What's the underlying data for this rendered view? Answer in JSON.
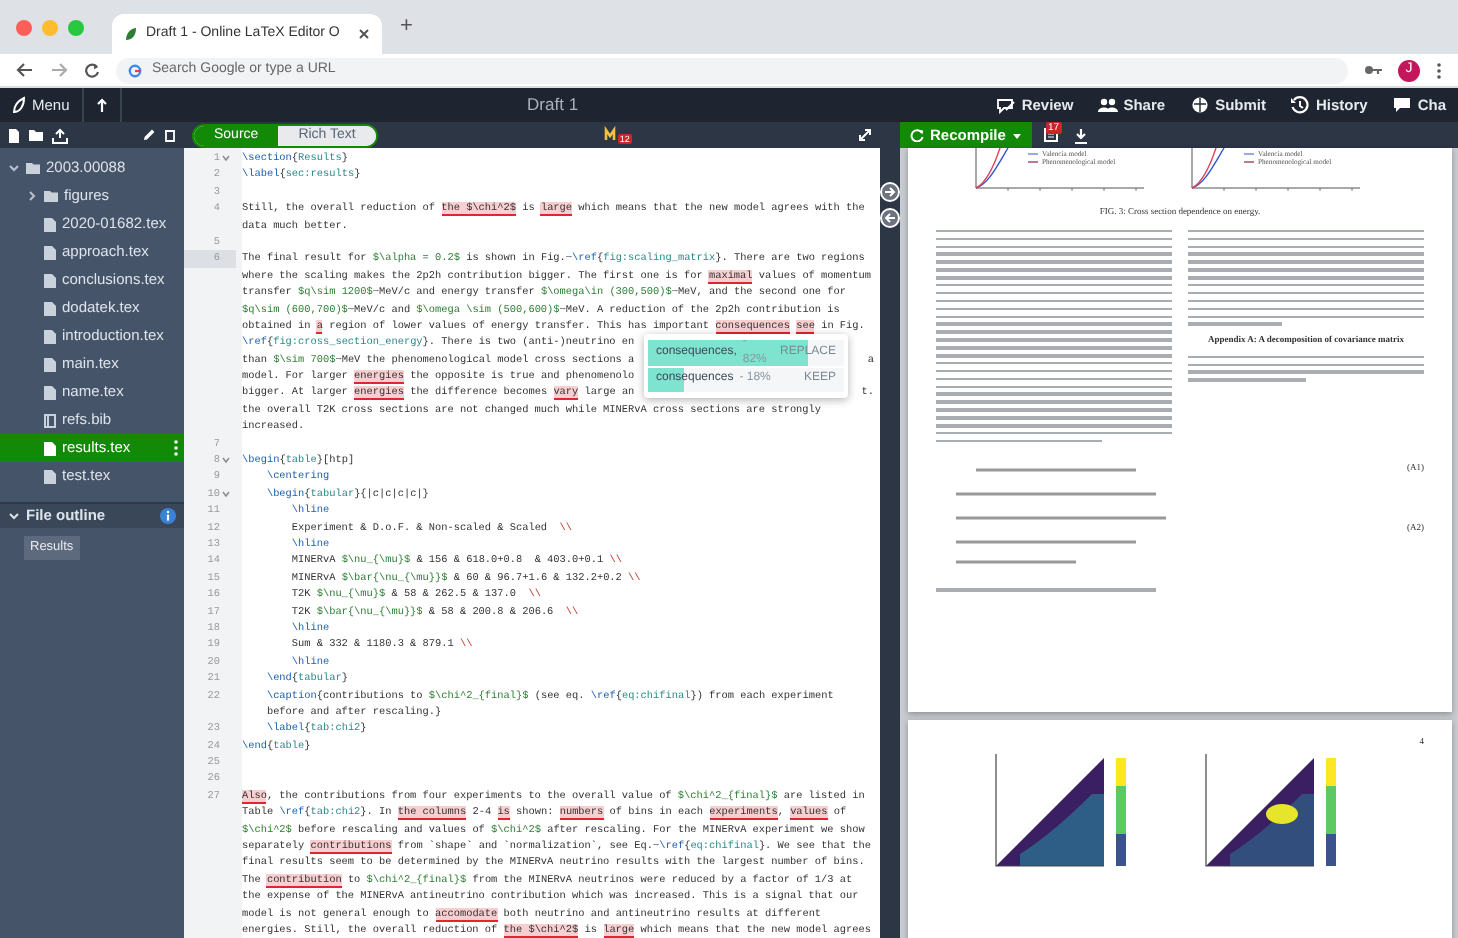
{
  "browser": {
    "tab_title": "Draft 1 - Online LaTeX Editor O",
    "new_tab": "+",
    "address_placeholder": "Search Google or type a URL",
    "avatar": "J"
  },
  "toolbar": {
    "menu": "Menu",
    "title": "Draft 1",
    "actions": [
      {
        "kind": "review",
        "label": "Review"
      },
      {
        "kind": "share",
        "label": "Share"
      },
      {
        "kind": "submit",
        "label": "Submit"
      },
      {
        "kind": "history",
        "label": "History"
      },
      {
        "kind": "chat",
        "label": "Cha"
      }
    ]
  },
  "file_tree": {
    "root": {
      "label": "2003.00088",
      "expanded": true,
      "children": [
        {
          "kind": "folder",
          "label": "figures",
          "selected": false
        },
        {
          "kind": "file",
          "label": "2020-01682.tex",
          "selected": false
        },
        {
          "kind": "file",
          "label": "approach.tex",
          "selected": false
        },
        {
          "kind": "file",
          "label": "conclusions.tex",
          "selected": false
        },
        {
          "kind": "file",
          "label": "dodatek.tex",
          "selected": false
        },
        {
          "kind": "file",
          "label": "introduction.tex",
          "selected": false
        },
        {
          "kind": "file",
          "label": "main.tex",
          "selected": false
        },
        {
          "kind": "file",
          "label": "name.tex",
          "selected": false
        },
        {
          "kind": "bib",
          "label": "refs.bib",
          "selected": false
        },
        {
          "kind": "file",
          "label": "results.tex",
          "selected": true
        },
        {
          "kind": "file",
          "label": "test.tex",
          "selected": false
        }
      ]
    }
  },
  "outline": {
    "title": "File outline",
    "expanded": true,
    "items": [
      "Results"
    ]
  },
  "editor": {
    "modes": [
      {
        "label": "Source",
        "selected": true
      },
      {
        "label": "Rich Text",
        "selected": false
      }
    ],
    "issues_badge": "12",
    "rows": [
      {
        "n": "1",
        "fold": true,
        "active": false,
        "segs": [
          {
            "kind": "cmd",
            "text": "\\section"
          },
          {
            "kind": "text",
            "text": "{"
          },
          {
            "kind": "arg",
            "text": "Results"
          },
          {
            "kind": "text",
            "text": "}"
          }
        ]
      },
      {
        "n": "2",
        "fold": false,
        "active": false,
        "segs": [
          {
            "kind": "cmd",
            "text": "\\label"
          },
          {
            "kind": "text",
            "text": "{"
          },
          {
            "kind": "arg",
            "text": "sec:results"
          },
          {
            "kind": "text",
            "text": "}"
          }
        ]
      },
      {
        "n": "3",
        "fold": false,
        "active": false,
        "segs": []
      },
      {
        "n": "4",
        "fold": false,
        "active": false,
        "segs": [
          {
            "kind": "text",
            "text": "Still, the overall reduction of "
          },
          {
            "kind": "flag",
            "text": "the $\\chi^2$"
          },
          {
            "kind": "text",
            "text": " is "
          },
          {
            "kind": "flag",
            "text": "large"
          },
          {
            "kind": "text",
            "text": " which means that the new model agrees with the"
          }
        ]
      },
      {
        "fold": false,
        "active": false,
        "segs": [
          {
            "kind": "text",
            "text": "data much better."
          }
        ]
      },
      {
        "n": "5",
        "fold": false,
        "active": false,
        "segs": []
      },
      {
        "n": "6",
        "fold": false,
        "active": true,
        "segs": [
          {
            "kind": "text",
            "text": "The final result for "
          },
          {
            "kind": "math",
            "text": "$\\alpha = 0.2$"
          },
          {
            "kind": "text",
            "text": " is shown in Fig.~"
          },
          {
            "kind": "cmd",
            "text": "\\ref"
          },
          {
            "kind": "text",
            "text": "{"
          },
          {
            "kind": "arg",
            "text": "fig:scaling_matrix"
          },
          {
            "kind": "text",
            "text": "}. There are two regions"
          }
        ]
      },
      {
        "fold": false,
        "active": false,
        "segs": [
          {
            "kind": "text",
            "text": "where the scaling makes the 2p2h contribution bigger. The first one is for "
          },
          {
            "kind": "flag",
            "text": "maximal"
          },
          {
            "kind": "text",
            "text": " values of momentum"
          }
        ]
      },
      {
        "fold": false,
        "active": false,
        "segs": [
          {
            "kind": "text",
            "text": "transfer "
          },
          {
            "kind": "math",
            "text": "$q\\sim 1200$"
          },
          {
            "kind": "text",
            "text": "~MeV/c and energy transfer "
          },
          {
            "kind": "math",
            "text": "$\\omega\\in (300,500)$"
          },
          {
            "kind": "text",
            "text": "~MeV, and the second one for"
          }
        ]
      },
      {
        "fold": false,
        "active": false,
        "segs": [
          {
            "kind": "math",
            "text": "$q\\sim (600,700)$"
          },
          {
            "kind": "text",
            "text": "~MeV/c and "
          },
          {
            "kind": "math",
            "text": "$\\omega \\sim (500,600)$"
          },
          {
            "kind": "text",
            "text": "~MeV. A reduction of the 2p2h contribution is"
          }
        ]
      },
      {
        "fold": false,
        "active": false,
        "segs": [
          {
            "kind": "text",
            "text": "obtained in "
          },
          {
            "kind": "flag",
            "text": "a"
          },
          {
            "kind": "text",
            "text": " region of lower values of energy transfer. This has important "
          },
          {
            "kind": "flag",
            "text": "consequences"
          },
          {
            "kind": "flag",
            "text": " see"
          },
          {
            "kind": "text",
            "text": " in Fig."
          }
        ]
      },
      {
        "fold": false,
        "active": false,
        "segs": [
          {
            "kind": "cmd",
            "text": "\\ref"
          },
          {
            "kind": "text",
            "text": "{"
          },
          {
            "kind": "arg",
            "text": "fig:cross_section_energy"
          },
          {
            "kind": "text",
            "text": "}. There is two (anti-)neutrino en"
          }
        ]
      },
      {
        "fold": false,
        "active": false,
        "segs": [
          {
            "kind": "text",
            "text": "than "
          },
          {
            "kind": "math",
            "text": "$\\sim 700$"
          },
          {
            "kind": "text",
            "text": "~MeV the phenomenological model cross sections a"
          }
        ],
        "tail": "a"
      },
      {
        "fold": false,
        "active": false,
        "segs": [
          {
            "kind": "text",
            "text": "model. For larger "
          },
          {
            "kind": "flag",
            "text": "energies"
          },
          {
            "kind": "text",
            "text": " the opposite is true and phenomenolo"
          }
        ]
      },
      {
        "fold": false,
        "active": false,
        "segs": [
          {
            "kind": "text",
            "text": "bigger. At larger "
          },
          {
            "kind": "flag",
            "text": "energies"
          },
          {
            "kind": "text",
            "text": " the difference becomes "
          },
          {
            "kind": "flag",
            "text": "vary"
          },
          {
            "kind": "text",
            "text": " large an"
          }
        ],
        "tail": "t."
      },
      {
        "fold": false,
        "active": false,
        "segs": [
          {
            "kind": "text",
            "text": "the overall T2K cross sections are not changed much while MINERvA cross sections are strongly"
          }
        ]
      },
      {
        "fold": false,
        "active": false,
        "segs": [
          {
            "kind": "text",
            "text": "increased."
          }
        ]
      },
      {
        "n": "7",
        "fold": false,
        "active": false,
        "segs": []
      },
      {
        "n": "8",
        "fold": true,
        "active": false,
        "segs": [
          {
            "kind": "cmd",
            "text": "\\begin"
          },
          {
            "kind": "text",
            "text": "{"
          },
          {
            "kind": "arg",
            "text": "table"
          },
          {
            "kind": "text",
            "text": "}[htp]"
          }
        ]
      },
      {
        "n": "9",
        "fold": false,
        "active": false,
        "segs": [
          {
            "kind": "cmd",
            "text": "    \\centering"
          }
        ]
      },
      {
        "n": "10",
        "fold": true,
        "active": false,
        "segs": [
          {
            "kind": "cmd",
            "text": "    \\begin"
          },
          {
            "kind": "text",
            "text": "{"
          },
          {
            "kind": "arg",
            "text": "tabular"
          },
          {
            "kind": "text",
            "text": "}{|c|c|c|c|}"
          }
        ]
      },
      {
        "n": "11",
        "fold": false,
        "active": false,
        "segs": [
          {
            "kind": "cmd",
            "text": "        \\hline"
          }
        ]
      },
      {
        "n": "12",
        "fold": false,
        "active": false,
        "segs": [
          {
            "kind": "text",
            "text": "        Experiment & D.o.F. & Non-scaled & Scaled  "
          },
          {
            "kind": "esc",
            "text": "\\\\"
          }
        ]
      },
      {
        "n": "13",
        "fold": false,
        "active": false,
        "segs": [
          {
            "kind": "cmd",
            "text": "        \\hline"
          }
        ]
      },
      {
        "n": "14",
        "fold": false,
        "active": false,
        "segs": [
          {
            "kind": "text",
            "text": "        MINERvA "
          },
          {
            "kind": "math",
            "text": "$\\nu_{\\mu}$"
          },
          {
            "kind": "text",
            "text": " & 156 & 618.0+0.8  & 403.0+0.1 "
          },
          {
            "kind": "esc",
            "text": "\\\\"
          }
        ]
      },
      {
        "n": "15",
        "fold": false,
        "active": false,
        "segs": [
          {
            "kind": "text",
            "text": "        MINERvA "
          },
          {
            "kind": "math",
            "text": "$\\bar{\\nu_{\\mu}}$"
          },
          {
            "kind": "text",
            "text": " & 60 & 96.7+1.6 & 132.2+0.2 "
          },
          {
            "kind": "esc",
            "text": "\\\\"
          }
        ]
      },
      {
        "n": "16",
        "fold": false,
        "active": false,
        "segs": [
          {
            "kind": "text",
            "text": "        T2K "
          },
          {
            "kind": "math",
            "text": "$\\nu_{\\mu}$"
          },
          {
            "kind": "text",
            "text": " & 58 & 262.5 & 137.0  "
          },
          {
            "kind": "esc",
            "text": "\\\\"
          }
        ]
      },
      {
        "n": "17",
        "fold": false,
        "active": false,
        "segs": [
          {
            "kind": "text",
            "text": "        T2K "
          },
          {
            "kind": "math",
            "text": "$\\bar{\\nu_{\\mu}}$"
          },
          {
            "kind": "text",
            "text": " & 58 & 200.8 & 206.6  "
          },
          {
            "kind": "esc",
            "text": "\\\\"
          }
        ]
      },
      {
        "n": "18",
        "fold": false,
        "active": false,
        "segs": [
          {
            "kind": "cmd",
            "text": "        \\hline"
          }
        ]
      },
      {
        "n": "19",
        "fold": false,
        "active": false,
        "segs": [
          {
            "kind": "text",
            "text": "        Sum & 332 & 1180.3 & 879.1 "
          },
          {
            "kind": "esc",
            "text": "\\\\"
          }
        ]
      },
      {
        "n": "20",
        "fold": false,
        "active": false,
        "segs": [
          {
            "kind": "cmd",
            "text": "        \\hline"
          }
        ]
      },
      {
        "n": "21",
        "fold": false,
        "active": false,
        "segs": [
          {
            "kind": "cmd",
            "text": "    \\end"
          },
          {
            "kind": "text",
            "text": "{"
          },
          {
            "kind": "arg",
            "text": "tabular"
          },
          {
            "kind": "text",
            "text": "}"
          }
        ]
      },
      {
        "n": "22",
        "fold": false,
        "active": false,
        "segs": [
          {
            "kind": "cmd",
            "text": "    \\caption"
          },
          {
            "kind": "text",
            "text": "{contributions to "
          },
          {
            "kind": "math",
            "text": "$\\chi^2_{final}$"
          },
          {
            "kind": "text",
            "text": " (see eq. "
          },
          {
            "kind": "cmd",
            "text": "\\ref"
          },
          {
            "kind": "text",
            "text": "{"
          },
          {
            "kind": "arg",
            "text": "eq:chifinal"
          },
          {
            "kind": "text",
            "text": "}) from each experiment"
          }
        ]
      },
      {
        "fold": false,
        "active": false,
        "segs": [
          {
            "kind": "text",
            "text": "    before and after rescaling.}"
          }
        ]
      },
      {
        "n": "23",
        "fold": false,
        "active": false,
        "segs": [
          {
            "kind": "cmd",
            "text": "    \\label"
          },
          {
            "kind": "text",
            "text": "{"
          },
          {
            "kind": "arg",
            "text": "tab:chi2"
          },
          {
            "kind": "text",
            "text": "}"
          }
        ]
      },
      {
        "n": "24",
        "fold": false,
        "active": false,
        "segs": [
          {
            "kind": "cmd",
            "text": "\\end"
          },
          {
            "kind": "text",
            "text": "{"
          },
          {
            "kind": "arg",
            "text": "table"
          },
          {
            "kind": "text",
            "text": "}"
          }
        ]
      },
      {
        "n": "25",
        "fold": false,
        "active": false,
        "segs": []
      },
      {
        "n": "26",
        "fold": false,
        "active": false,
        "segs": []
      },
      {
        "n": "27",
        "fold": false,
        "active": false,
        "segs": [
          {
            "kind": "flag",
            "text": "Also"
          },
          {
            "kind": "text",
            "text": ", the contributions from four experiments to the overall value of "
          },
          {
            "kind": "math",
            "text": "$\\chi^2_{final}$"
          },
          {
            "kind": "text",
            "text": " are listed in"
          }
        ]
      },
      {
        "fold": false,
        "active": false,
        "segs": [
          {
            "kind": "text",
            "text": "Table "
          },
          {
            "kind": "cmd",
            "text": "\\ref"
          },
          {
            "kind": "text",
            "text": "{"
          },
          {
            "kind": "arg",
            "text": "tab:chi2"
          },
          {
            "kind": "text",
            "text": "}. In "
          },
          {
            "kind": "flag",
            "text": "the columns"
          },
          {
            "kind": "text",
            "text": " 2-4 "
          },
          {
            "kind": "flag",
            "text": "is"
          },
          {
            "kind": "text",
            "text": " shown: "
          },
          {
            "kind": "flag",
            "text": "numbers"
          },
          {
            "kind": "text",
            "text": " of bins in each "
          },
          {
            "kind": "flag",
            "text": "experiments"
          },
          {
            "kind": "text",
            "text": ", "
          },
          {
            "kind": "flag",
            "text": "values"
          },
          {
            "kind": "text",
            "text": " of"
          }
        ]
      },
      {
        "fold": false,
        "active": false,
        "segs": [
          {
            "kind": "math",
            "text": "$\\chi^2$"
          },
          {
            "kind": "text",
            "text": " before rescaling and values of "
          },
          {
            "kind": "math",
            "text": "$\\chi^2$"
          },
          {
            "kind": "text",
            "text": " after rescaling. For the MINERvA experiment we show"
          }
        ]
      },
      {
        "fold": false,
        "active": false,
        "segs": [
          {
            "kind": "text",
            "text": "separately "
          },
          {
            "kind": "flag",
            "text": "contributions"
          },
          {
            "kind": "text",
            "text": " from `shape` and `normalization`, see Eq.~"
          },
          {
            "kind": "cmd",
            "text": "\\ref"
          },
          {
            "kind": "text",
            "text": "{"
          },
          {
            "kind": "arg",
            "text": "eq:chifinal"
          },
          {
            "kind": "text",
            "text": "}. We see that the"
          }
        ]
      },
      {
        "fold": false,
        "active": false,
        "segs": [
          {
            "kind": "text",
            "text": "final results seem to be determined by the MINERvA neutrino results with the largest number of bins."
          }
        ]
      },
      {
        "fold": false,
        "active": false,
        "segs": [
          {
            "kind": "text",
            "text": "The "
          },
          {
            "kind": "flag",
            "text": "contribution"
          },
          {
            "kind": "text",
            "text": " to "
          },
          {
            "kind": "math",
            "text": "$\\chi^2_{final}$"
          },
          {
            "kind": "text",
            "text": " from the MINERvA neutrinos were reduced by a factor of 1/3 at"
          }
        ]
      },
      {
        "fold": false,
        "active": false,
        "segs": [
          {
            "kind": "text",
            "text": "the expense of the MINERvA antineutrino contribution which was increased. This is a signal that our"
          }
        ]
      },
      {
        "fold": false,
        "active": false,
        "segs": [
          {
            "kind": "text",
            "text": "model is not general enough to "
          },
          {
            "kind": "flag",
            "text": "accomodate"
          },
          {
            "kind": "text",
            "text": " both neutrino and antineutrino results at different"
          }
        ]
      },
      {
        "fold": false,
        "active": false,
        "segs": [
          {
            "kind": "text",
            "text": "energies. Still, the overall reduction of "
          },
          {
            "kind": "flag",
            "text": "the $\\chi^2$"
          },
          {
            "kind": "text",
            "text": " is "
          },
          {
            "kind": "flag",
            "text": "large"
          },
          {
            "kind": "text",
            "text": " which means that the new model agrees"
          }
        ]
      }
    ],
    "suggestions": [
      {
        "word": "consequences,",
        "score": "- 82%",
        "level": 0.82,
        "action": "REPLACE"
      },
      {
        "word": "consequences",
        "score": "- 18%",
        "level": 0.18,
        "action": "KEEP"
      }
    ]
  },
  "pdf": {
    "recompile": "Recompile",
    "log_badge": "17",
    "plots": [
      {
        "legend": [
          "Valencia model",
          "Phenomenological model"
        ]
      },
      {
        "legend": [
          "Valencia model",
          "Phenomenological model"
        ]
      }
    ],
    "figure_caption": "FIG. 3: Cross section dependence on energy.",
    "appendix_heading": "Appendix A: A decomposition of covariance matrix",
    "equation_numbers": [
      "(A1)",
      "(A2)"
    ],
    "page_number": "4"
  }
}
